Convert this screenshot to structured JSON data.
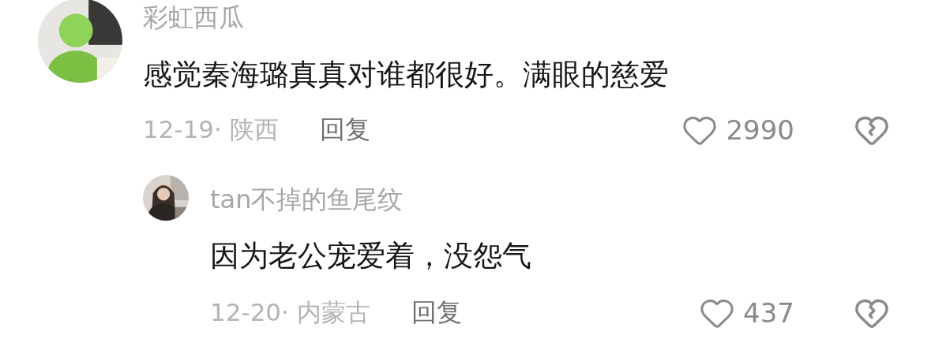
{
  "comments": [
    {
      "user": "彩虹西瓜",
      "text": "感觉秦海璐真真对谁都很好。满眼的慈爱",
      "date_location": "12-19· 陕西",
      "reply_label": "回复",
      "likes": "2990",
      "replies": [
        {
          "user": "tan不掉的鱼尾纹",
          "text": "因为老公宠爱着，没怨气",
          "date_location": "12-20· 内蒙古",
          "reply_label": "回复",
          "likes": "437"
        }
      ]
    }
  ]
}
